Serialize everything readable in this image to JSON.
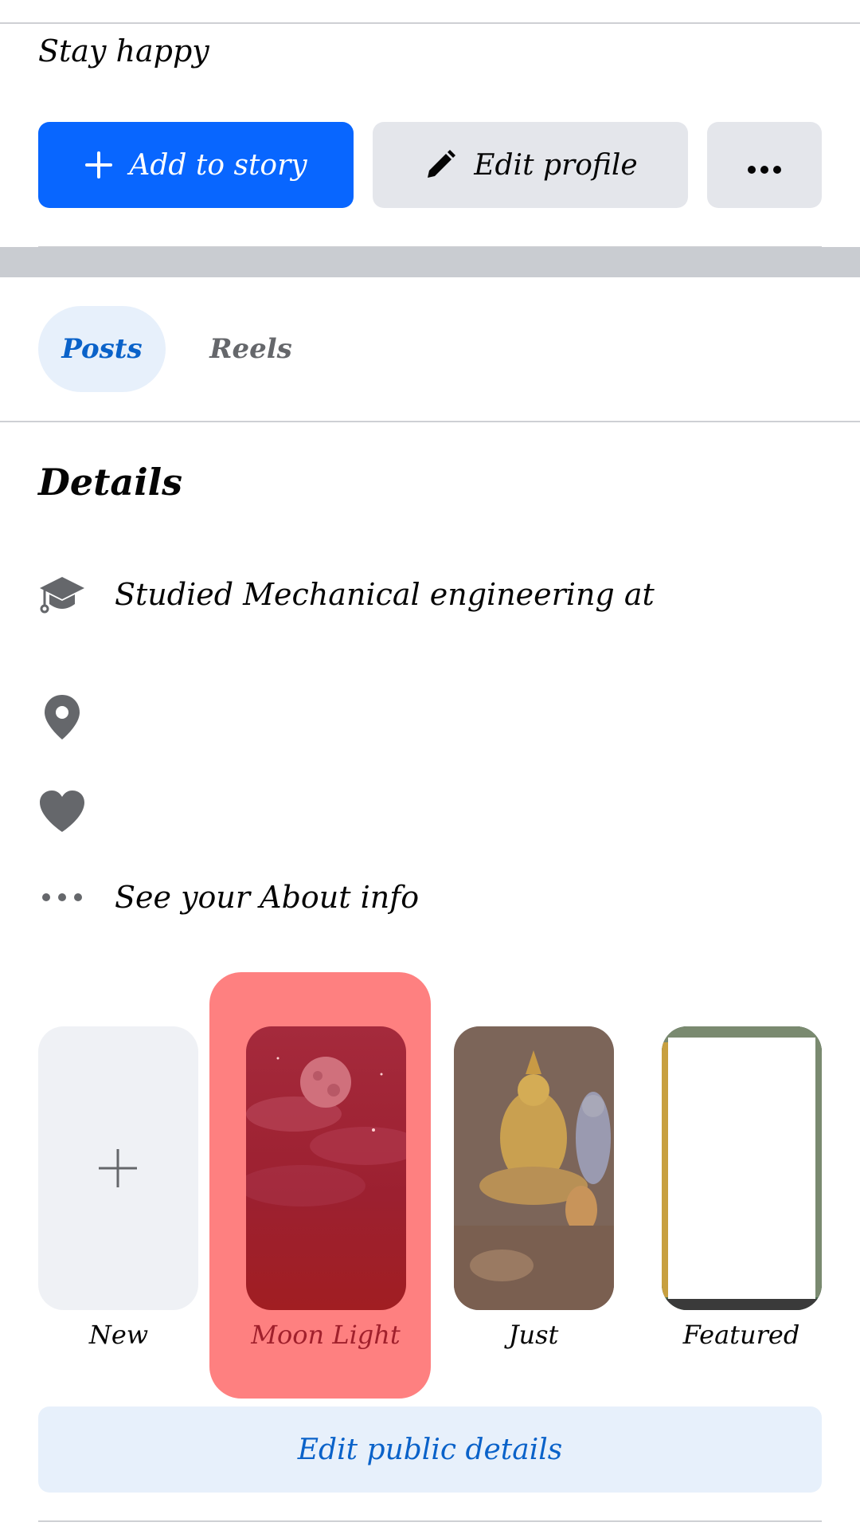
{
  "profile": {
    "bio": "Stay happy",
    "add_to_story_label": "Add to story",
    "edit_profile_label": "Edit profile"
  },
  "tabs": [
    {
      "label": "Posts",
      "active": true
    },
    {
      "label": "Reels",
      "active": false
    }
  ],
  "details": {
    "title": "Details",
    "items": [
      {
        "icon": "graduation-cap-icon",
        "text": "Studied Mechanical engineering at"
      },
      {
        "icon": "location-pin-icon",
        "text": ""
      },
      {
        "icon": "heart-icon",
        "text": ""
      },
      {
        "icon": "more-dots-icon",
        "text": "See your About info"
      }
    ]
  },
  "highlights": [
    {
      "label": "New"
    },
    {
      "label": "Moon Light"
    },
    {
      "label": "Just"
    },
    {
      "label": "Featured"
    }
  ],
  "edit_public_details_label": "Edit public details",
  "colors": {
    "primary": "#0866ff",
    "link": "#0a62c9",
    "highlight": "#fe8080",
    "secondary_button": "#e4e6eb",
    "divider": "#c9ccd1"
  }
}
